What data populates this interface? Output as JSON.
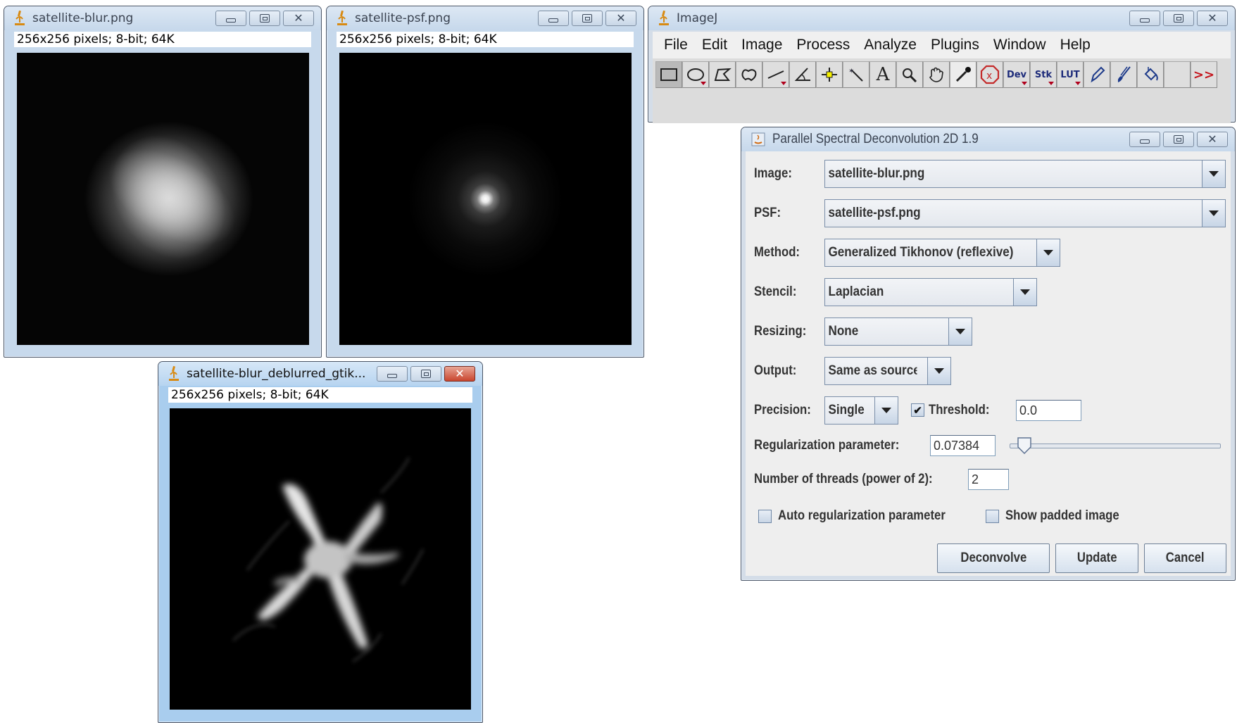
{
  "windows": {
    "blur": {
      "title": "satellite-blur.png",
      "info": "256x256 pixels; 8-bit; 64K"
    },
    "psf": {
      "title": "satellite-psf.png",
      "info": "256x256 pixels; 8-bit; 64K"
    },
    "deblurred": {
      "title": "satellite-blur_deblurred_gtik...",
      "info": "256x256 pixels; 8-bit; 64K"
    }
  },
  "imagej": {
    "title": "ImageJ",
    "menu": [
      "File",
      "Edit",
      "Image",
      "Process",
      "Analyze",
      "Plugins",
      "Window",
      "Help"
    ],
    "tools": [
      {
        "name": "rectangle-tool",
        "selected": true
      },
      {
        "name": "oval-tool"
      },
      {
        "name": "polygon-tool"
      },
      {
        "name": "freehand-tool"
      },
      {
        "name": "line-tool"
      },
      {
        "name": "angle-tool"
      },
      {
        "name": "point-tool"
      },
      {
        "name": "wand-tool"
      },
      {
        "name": "text-tool"
      },
      {
        "name": "magnifier-tool"
      },
      {
        "name": "hand-tool"
      },
      {
        "name": "color-picker-tool"
      },
      {
        "name": "close-all-tool"
      },
      {
        "name": "dev-menu",
        "label": "Dev"
      },
      {
        "name": "stk-menu",
        "label": "Stk"
      },
      {
        "name": "lut-menu",
        "label": "LUT"
      },
      {
        "name": "pencil-tool"
      },
      {
        "name": "brush-tool"
      },
      {
        "name": "flood-fill-tool"
      },
      {
        "name": "empty-slot"
      },
      {
        "name": "more-tools",
        "label": ">>"
      }
    ]
  },
  "dialog": {
    "title": "Parallel Spectral Deconvolution 2D 1.9",
    "image_label": "Image:",
    "image_value": "satellite-blur.png",
    "psf_label": "PSF:",
    "psf_value": "satellite-psf.png",
    "method_label": "Method:",
    "method_value": "Generalized Tikhonov (reflexive)",
    "stencil_label": "Stencil:",
    "stencil_value": "Laplacian",
    "resizing_label": "Resizing:",
    "resizing_value": "None",
    "output_label": "Output:",
    "output_value": "Same as source",
    "precision_label": "Precision:",
    "precision_value": "Single",
    "threshold_checked": true,
    "threshold_label": "Threshold:",
    "threshold_value": "0.0",
    "reg_label": "Regularization parameter:",
    "reg_value": "0.07384",
    "reg_slider_fraction": 0.07,
    "threads_label": "Number of threads (power of 2):",
    "threads_value": "2",
    "auto_reg_label": "Auto regularization parameter",
    "auto_reg_checked": false,
    "show_padded_label": "Show padded image",
    "show_padded_checked": false,
    "deconvolve_label": "Deconvolve",
    "update_label": "Update",
    "cancel_label": "Cancel",
    "check_glyph": "✔"
  }
}
